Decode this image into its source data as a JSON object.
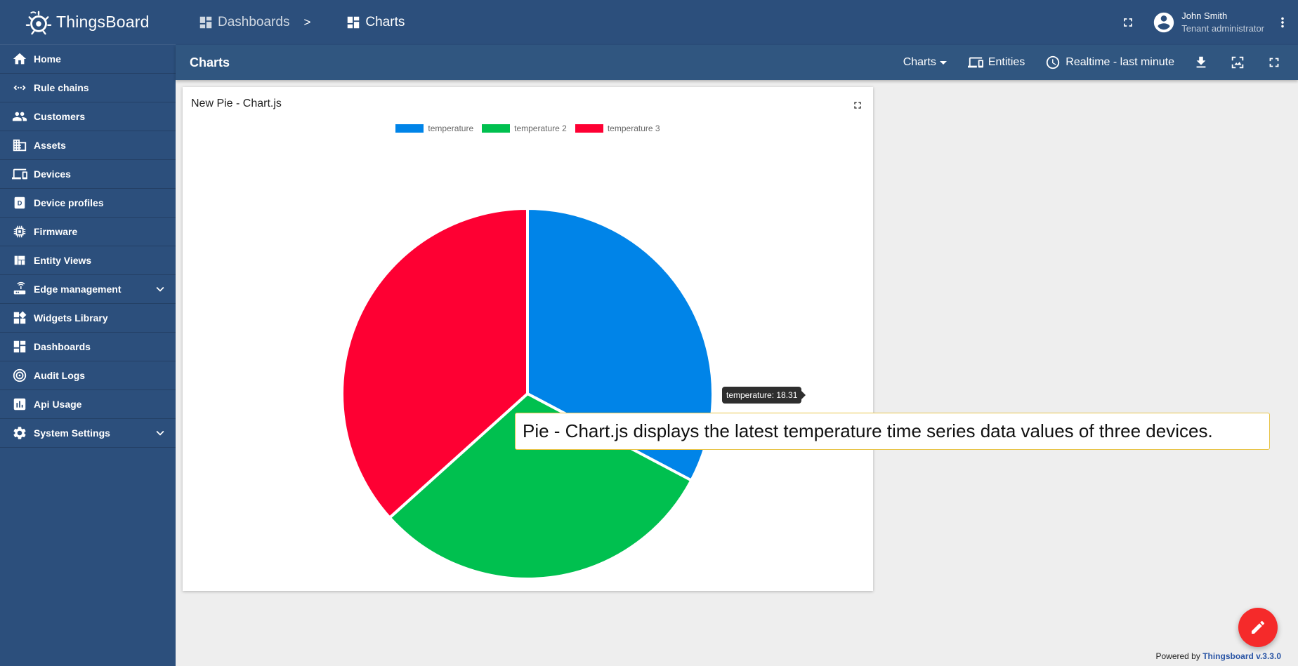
{
  "app": {
    "name": "ThingsBoard"
  },
  "breadcrumb": [
    {
      "label": "Dashboards",
      "icon": "dashboard-icon"
    },
    {
      "label": "Charts",
      "icon": "dashboard-icon"
    }
  ],
  "breadcrumb_separator": ">",
  "user": {
    "name": "John Smith",
    "role": "Tenant administrator"
  },
  "sidebar": {
    "items": [
      {
        "label": "Home",
        "icon": "home-icon"
      },
      {
        "label": "Rule chains",
        "icon": "rule-chain-icon"
      },
      {
        "label": "Customers",
        "icon": "customers-icon"
      },
      {
        "label": "Assets",
        "icon": "assets-icon"
      },
      {
        "label": "Devices",
        "icon": "devices-icon"
      },
      {
        "label": "Device profiles",
        "icon": "device-profile-icon"
      },
      {
        "label": "Firmware",
        "icon": "firmware-icon"
      },
      {
        "label": "Entity Views",
        "icon": "entity-views-icon"
      },
      {
        "label": "Edge management",
        "icon": "router-icon",
        "expandable": true
      },
      {
        "label": "Widgets Library",
        "icon": "widgets-icon"
      },
      {
        "label": "Dashboards",
        "icon": "dashboard-icon"
      },
      {
        "label": "Audit Logs",
        "icon": "audit-icon"
      },
      {
        "label": "Api Usage",
        "icon": "bar-chart-icon"
      },
      {
        "label": "System Settings",
        "icon": "gear-icon",
        "expandable": true
      }
    ]
  },
  "toolbar": {
    "title": "Charts",
    "state_label": "Charts",
    "entities_label": "Entities",
    "timewindow_label": "Realtime - last minute"
  },
  "widget": {
    "title": "New Pie - Chart.js",
    "tooltip": "temperature: 18.31"
  },
  "chart_data": {
    "type": "pie",
    "categories": [
      "temperature",
      "temperature 2",
      "temperature 3"
    ],
    "values": [
      18.31,
      17.1,
      20.5
    ],
    "colors": [
      "#0084e8",
      "#00c04f",
      "#fe0033"
    ],
    "legend": "top"
  },
  "caption": "Pie - Chart.js displays the latest temperature time series data values of three devices.",
  "footer": {
    "prefix": "Powered by",
    "brand": "Thingsboard v.3.3.0"
  }
}
